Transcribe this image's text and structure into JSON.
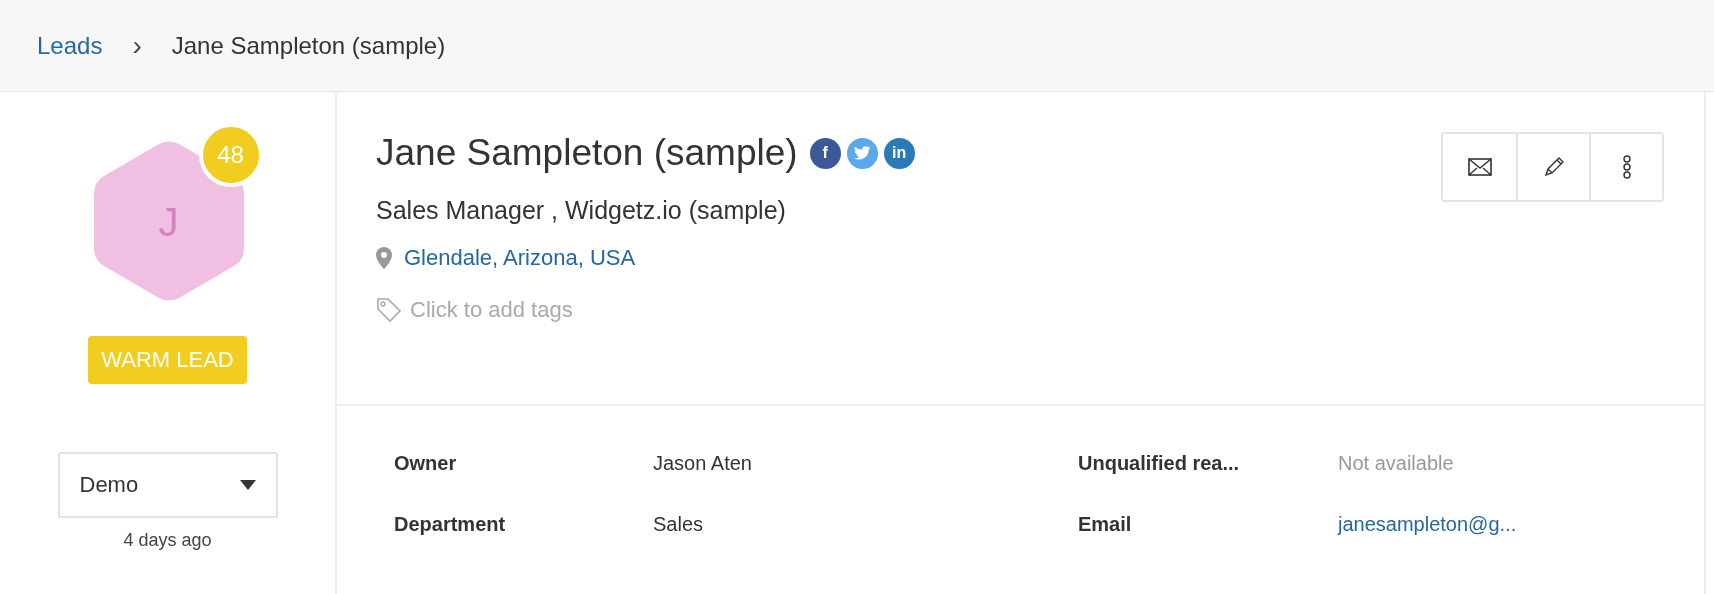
{
  "breadcrumb": {
    "parent": "Leads",
    "separator": "›",
    "current": "Jane Sampleton (sample)"
  },
  "avatar": {
    "initial": "J",
    "score": "48"
  },
  "status_badge": "WARM LEAD",
  "stage_dropdown": {
    "value": "Demo",
    "updated": "4 days ago"
  },
  "profile": {
    "name": "Jane Sampleton (sample)",
    "social": [
      {
        "kind": "facebook",
        "label": "f",
        "color": "#3b5998"
      },
      {
        "kind": "twitter",
        "color": "#5aa9ec"
      },
      {
        "kind": "linkedin",
        "label": "in",
        "color": "#2a7ab8"
      }
    ],
    "job": "Sales Manager , Widgetz.io (sample)",
    "location": "Glendale, Arizona, USA",
    "tags_placeholder": "Click to add tags"
  },
  "actions": [
    {
      "kind": "email"
    },
    {
      "kind": "edit"
    },
    {
      "kind": "more"
    }
  ],
  "fields": [
    {
      "label": "Owner",
      "value": "Jason Aten",
      "kind": "text"
    },
    {
      "label": "Unqualified rea...",
      "value": "Not available",
      "kind": "muted"
    },
    {
      "label": "Department",
      "value": "Sales",
      "kind": "text"
    },
    {
      "label": "Email",
      "value": "janesampleton@g...",
      "kind": "link"
    }
  ]
}
